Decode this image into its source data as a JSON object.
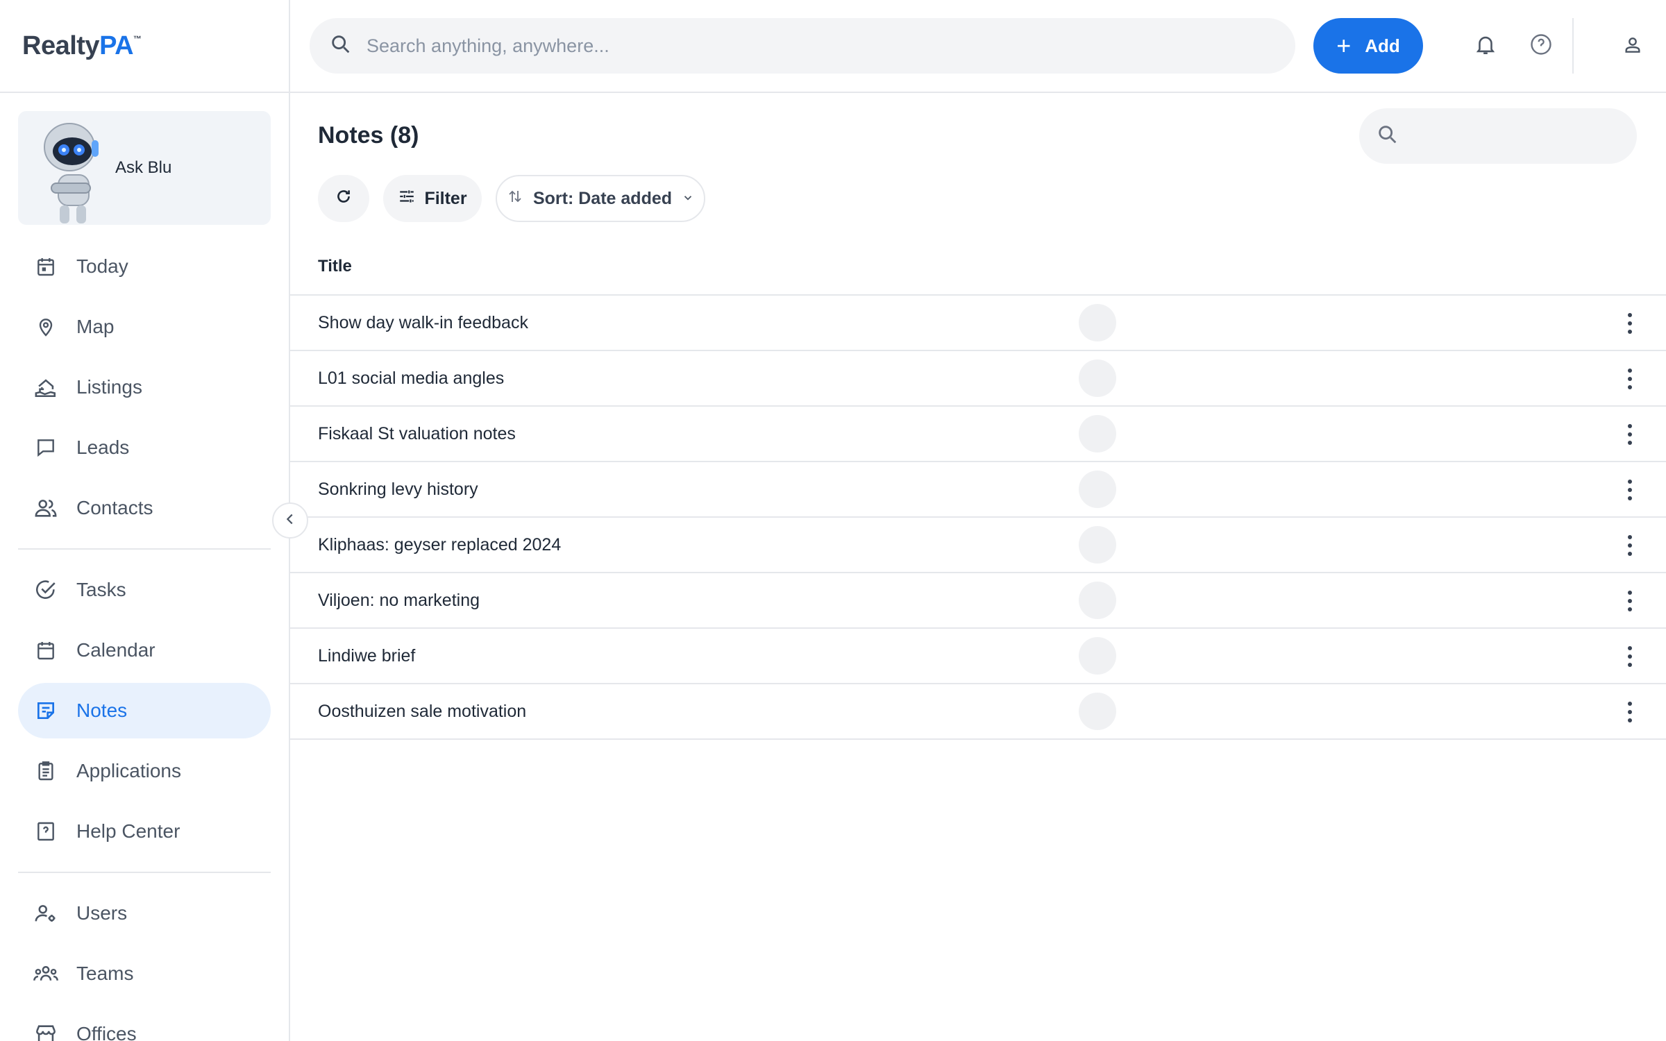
{
  "app": {
    "logo_main": "Realty",
    "logo_accent": "PA",
    "logo_tm": "™"
  },
  "header": {
    "search_placeholder": "Search anything, anywhere...",
    "add_label": "Add"
  },
  "sidebar": {
    "ask_label": "Ask Blu",
    "groups": [
      [
        {
          "label": "Today",
          "icon": "calendar-day-icon"
        },
        {
          "label": "Map",
          "icon": "map-pin-icon"
        },
        {
          "label": "Listings",
          "icon": "house-hand-icon"
        },
        {
          "label": "Leads",
          "icon": "chat-bubble-icon"
        },
        {
          "label": "Contacts",
          "icon": "users-icon"
        }
      ],
      [
        {
          "label": "Tasks",
          "icon": "check-circle-icon"
        },
        {
          "label": "Calendar",
          "icon": "calendar-icon"
        },
        {
          "label": "Notes",
          "icon": "note-icon",
          "active": true
        },
        {
          "label": "Applications",
          "icon": "clipboard-icon"
        },
        {
          "label": "Help Center",
          "icon": "help-square-icon"
        }
      ],
      [
        {
          "label": "Users",
          "icon": "user-gear-icon"
        },
        {
          "label": "Teams",
          "icon": "team-icon"
        },
        {
          "label": "Offices",
          "icon": "store-icon"
        }
      ]
    ]
  },
  "main": {
    "title": "Notes (8)",
    "filter_label": "Filter",
    "sort_label": "Sort: Date added",
    "column_title": "Title",
    "notes": [
      "Show day walk-in feedback",
      "L01 social media angles",
      "Fiskaal St valuation notes",
      "Sonkring levy history",
      "Kliphaas: geyser replaced 2024",
      "Viljoen: no marketing",
      "Lindiwe brief",
      "Oosthuizen sale motivation"
    ]
  },
  "colors": {
    "accent": "#1a73e8",
    "active_bg": "#e8f1fd",
    "surface": "#f3f4f6"
  }
}
